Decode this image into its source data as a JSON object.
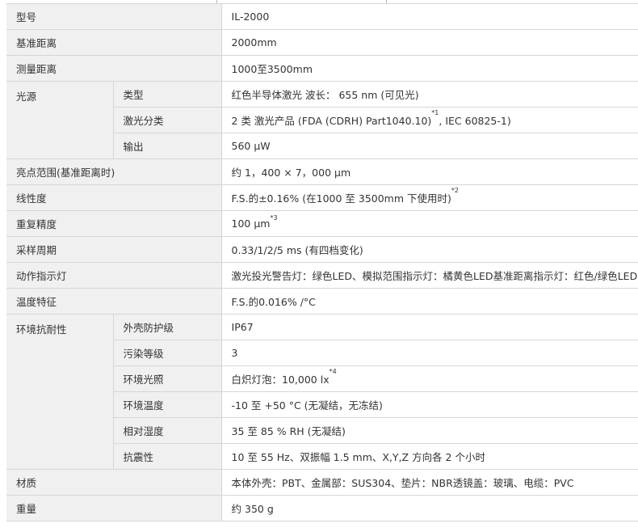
{
  "rows": {
    "model": {
      "label": "型号",
      "value": "IL-2000"
    },
    "ref_distance": {
      "label": "基准距离",
      "value": "2000mm"
    },
    "measure_range": {
      "label": "测量距离",
      "value": "1000至3500mm"
    },
    "light_source": {
      "label": "光源",
      "type": {
        "label": "类型",
        "value": "红色半导体激光 波长： 655 nm (可见光)"
      },
      "laser_class": {
        "label": "激光分类",
        "value_pre": "2 类 激光产品 (FDA (CDRH) Part1040.10)",
        "note": "*1",
        "value_post": ", IEC 60825-1)"
      },
      "output": {
        "label": "输出",
        "value": "560 μW"
      }
    },
    "spot_size": {
      "label": "亮点范围(基准距离时)",
      "value": "约 1，400 × 7，000 μm"
    },
    "linearity": {
      "label": "线性度",
      "value": "F.S.的±0.16% (在1000 至 3500mm 下使用时)",
      "note": "*2"
    },
    "repeatability": {
      "label": "重复精度",
      "value": "100 μm",
      "note": "*3"
    },
    "sampling": {
      "label": "采样周期",
      "value": "0.33/1/2/5 ms (有四档变化)"
    },
    "indicator": {
      "label": "动作指示灯",
      "value": "激光投光警告灯：绿色LED、模拟范围指示灯：橘黄色LED基准距离指示灯：红色/绿色LED"
    },
    "temp_char": {
      "label": "温度特征",
      "value": "F.S.的0.016% /°C"
    },
    "environment": {
      "label": "环境抗耐性",
      "enclosure": {
        "label": "外壳防护级",
        "value": "IP67"
      },
      "pollution": {
        "label": "污染等级",
        "value": "3"
      },
      "ambient_light": {
        "label": "环境光照",
        "value": "白炽灯泡：10,000 lx",
        "note": "*4"
      },
      "ambient_temp": {
        "label": "环境温度",
        "value": "-10 至 +50 °C (无凝结，无冻结)"
      },
      "humidity": {
        "label": "相对湿度",
        "value": "35 至 85 % RH (无凝结)"
      },
      "vibration": {
        "label": "抗震性",
        "value": "10 至 55 Hz、双振幅 1.5 mm、X,Y,Z 方向各 2 个小时"
      }
    },
    "material": {
      "label": "材质",
      "value": "本体外壳：PBT、金属部：SUS304、垫片：NBR透镜盖：玻璃、电缆：PVC"
    },
    "weight": {
      "label": "重量",
      "value": "约 350 g"
    }
  }
}
